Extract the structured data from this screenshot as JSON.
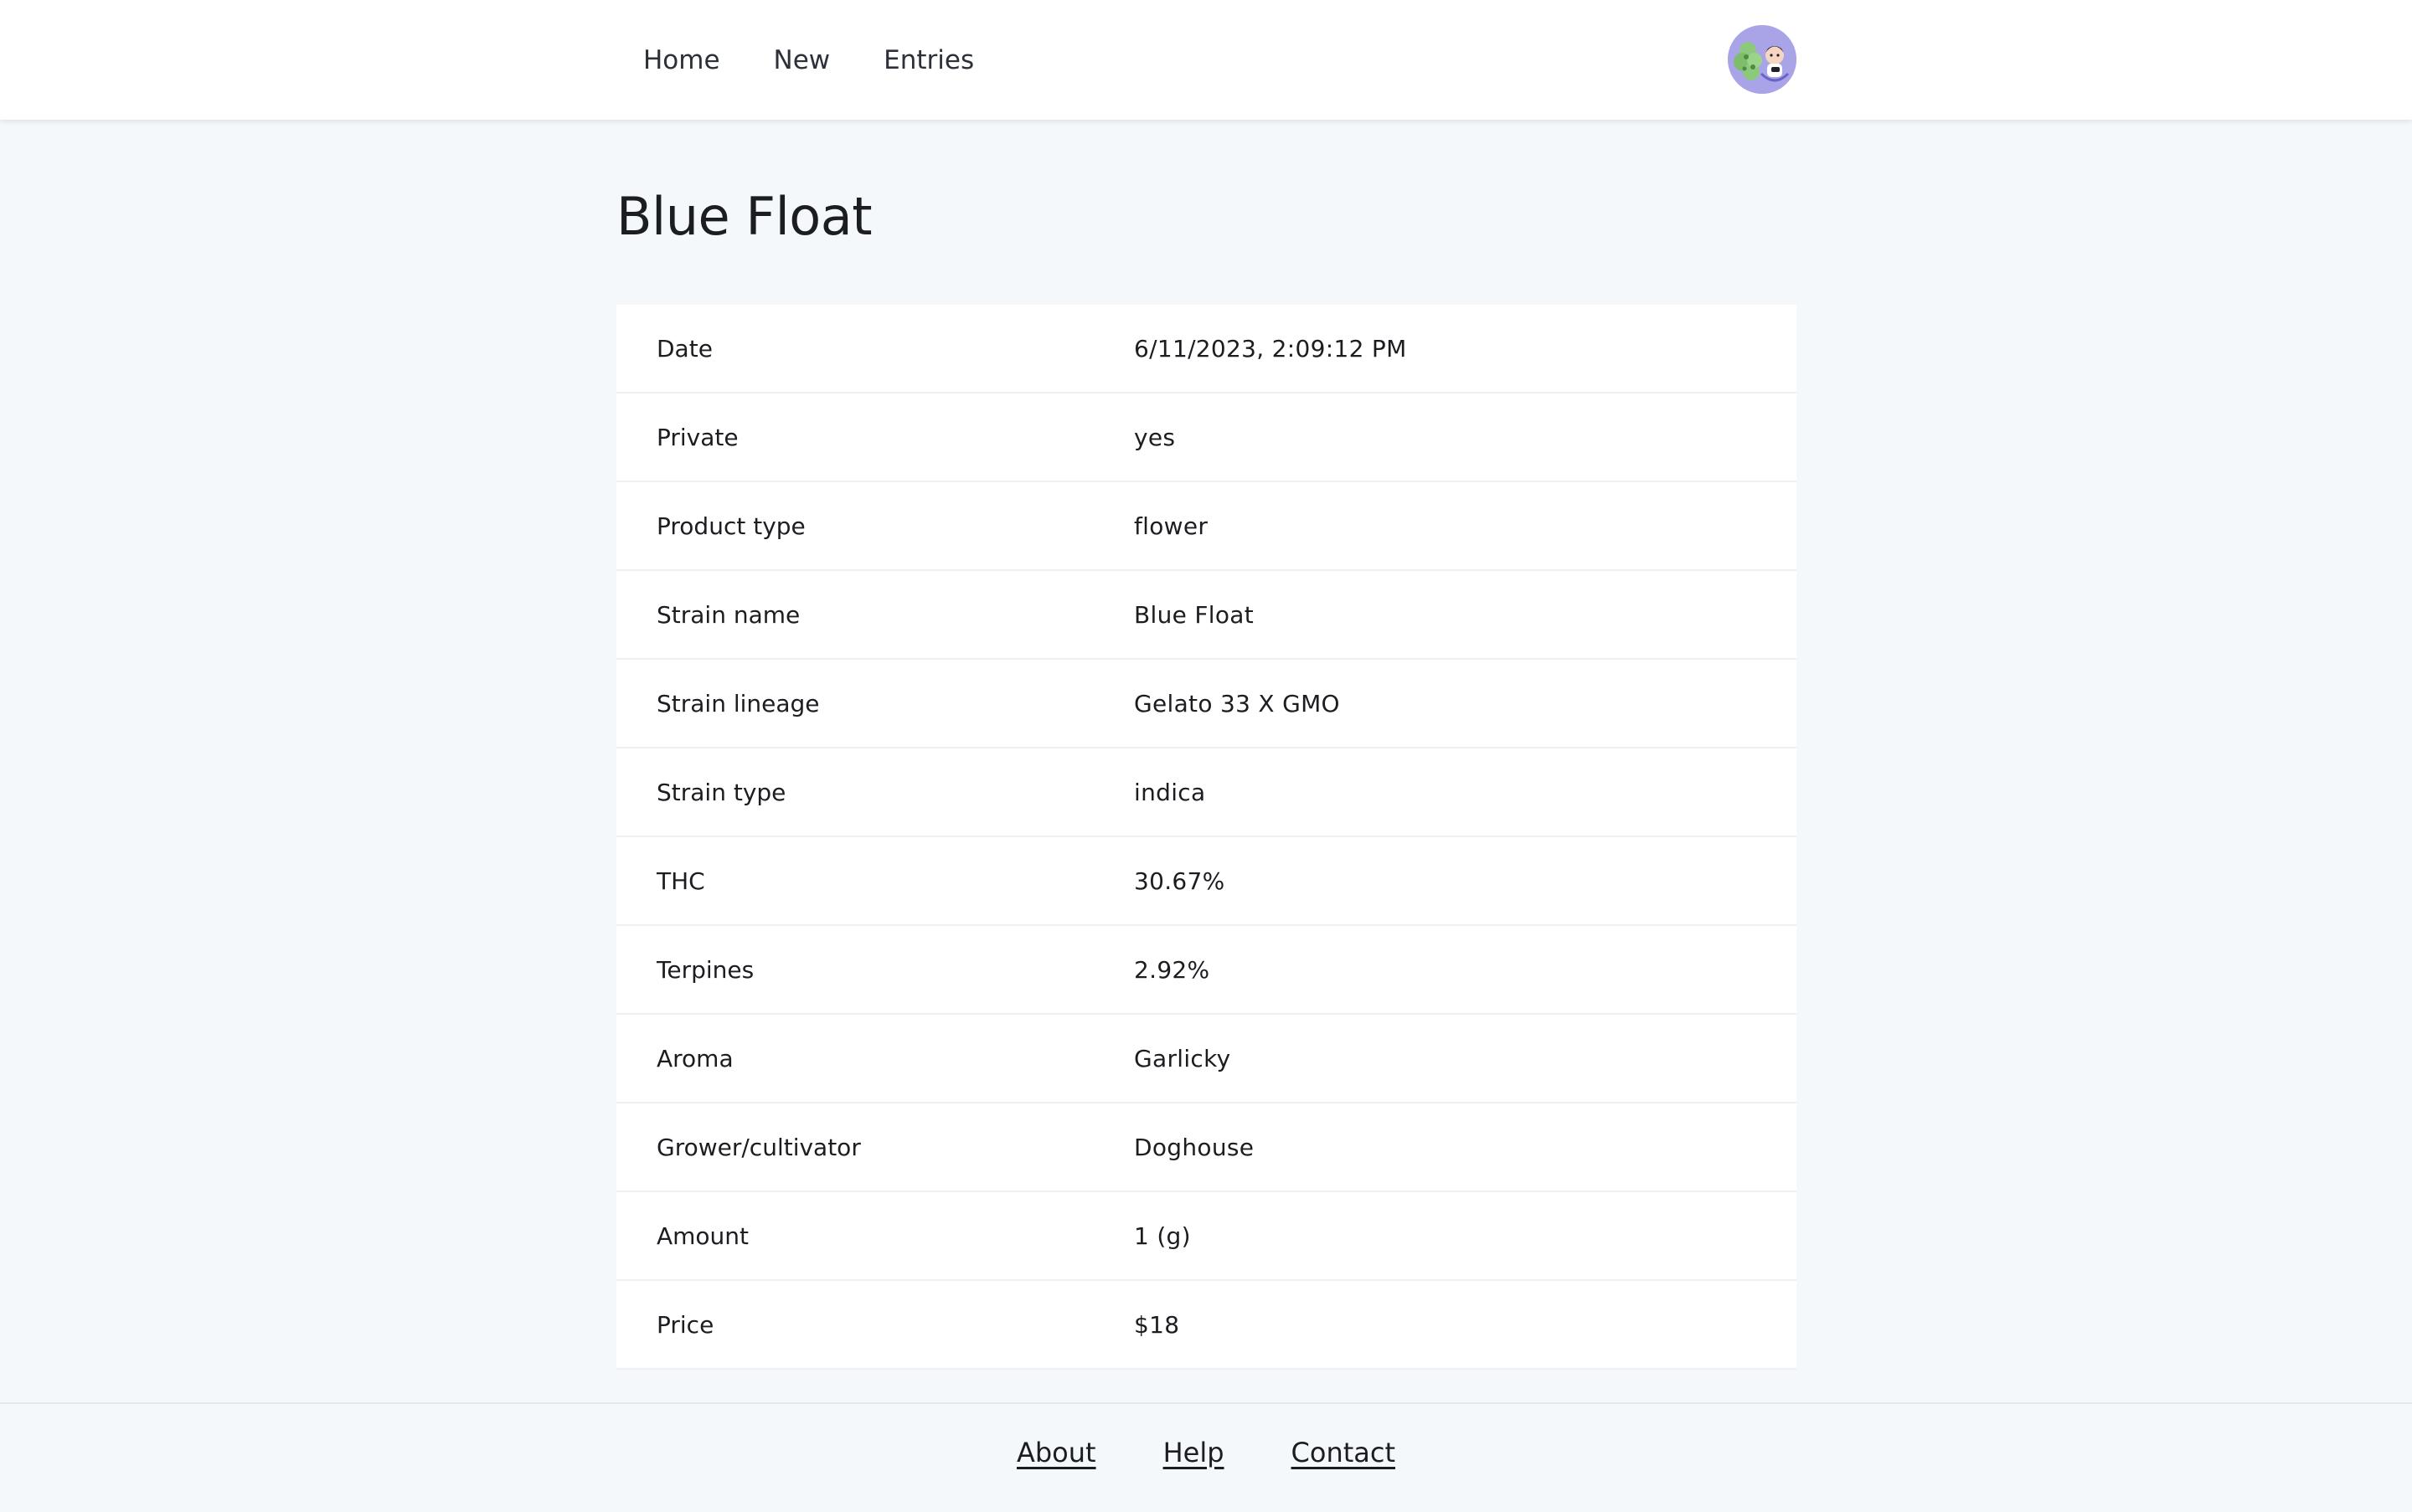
{
  "nav": {
    "items": [
      {
        "label": "Home"
      },
      {
        "label": "New"
      },
      {
        "label": "Entries"
      }
    ]
  },
  "user": {
    "avatar_icon": "user-avatar-icon",
    "avatar_bg": "#a9a3e8"
  },
  "page": {
    "title": "Blue Float"
  },
  "details": [
    {
      "label": "Date",
      "value": "6/11/2023, 2:09:12 PM"
    },
    {
      "label": "Private",
      "value": "yes"
    },
    {
      "label": "Product type",
      "value": "flower"
    },
    {
      "label": "Strain name",
      "value": "Blue Float"
    },
    {
      "label": "Strain lineage",
      "value": "Gelato 33 X GMO"
    },
    {
      "label": "Strain type",
      "value": "indica"
    },
    {
      "label": "THC",
      "value": "30.67%"
    },
    {
      "label": "Terpines",
      "value": "2.92%"
    },
    {
      "label": "Aroma",
      "value": "Garlicky"
    },
    {
      "label": "Grower/cultivator",
      "value": "Doghouse"
    },
    {
      "label": "Amount",
      "value": "1 (g)"
    },
    {
      "label": "Price",
      "value": "$18"
    }
  ],
  "footer": {
    "links": [
      {
        "label": "About"
      },
      {
        "label": "Help"
      },
      {
        "label": "Contact"
      }
    ]
  },
  "colors": {
    "page_bg": "#f5f8fb",
    "header_bg": "#ffffff",
    "text": "#1b1d21"
  }
}
